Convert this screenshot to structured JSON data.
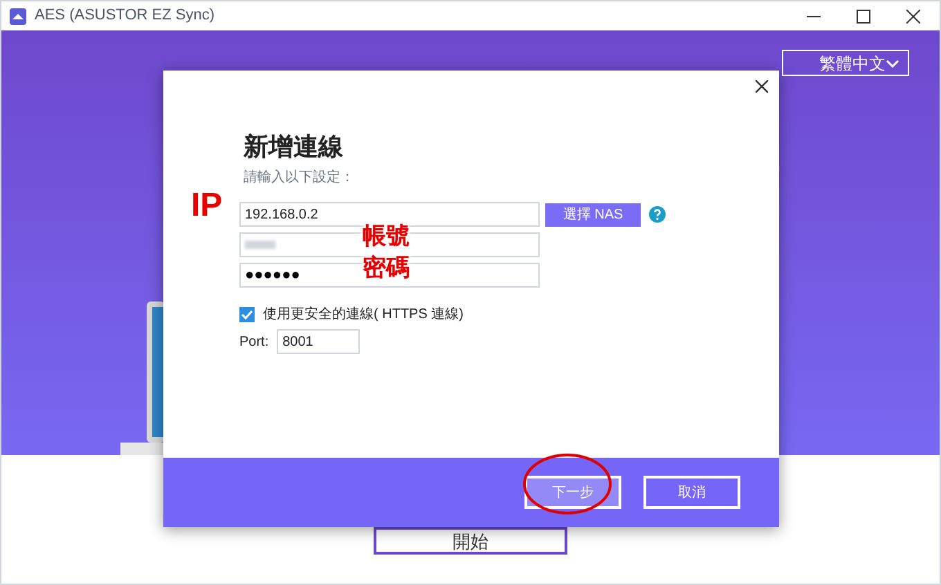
{
  "window": {
    "title": "AES (ASUSTOR EZ Sync)"
  },
  "language_select": {
    "value": "繁體中文"
  },
  "background_button": {
    "label": "開始"
  },
  "dialog": {
    "title": "新增連線",
    "subtitle": "請輸入以下設定：",
    "ip_field": {
      "value": "192.168.0.2"
    },
    "choose_nas_button": {
      "label": "選擇 NAS"
    },
    "password_field": {
      "value": "●●●●●●"
    },
    "secure_checkbox": {
      "label": "使用更安全的連線( HTTPS 連線)",
      "checked": true
    },
    "port": {
      "label": "Port:",
      "value": "8001"
    },
    "buttons": [
      {
        "label": "下一步",
        "selected": true
      },
      {
        "label": "取消",
        "selected": false
      }
    ]
  },
  "annotations": [
    {
      "text": "IP"
    },
    {
      "text": "帳號"
    },
    {
      "text": "密碼"
    }
  ]
}
